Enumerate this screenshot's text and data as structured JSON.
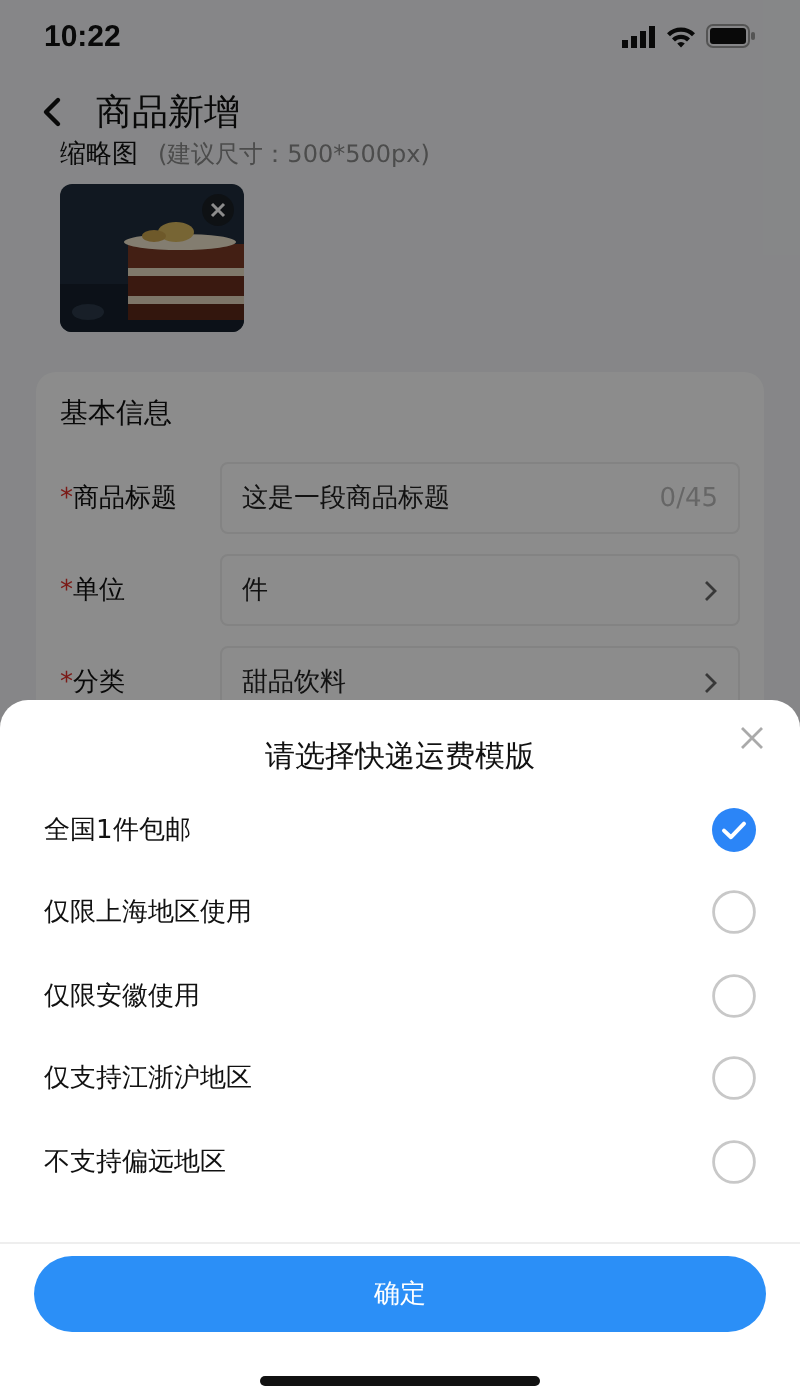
{
  "status_bar": {
    "time": "10:22"
  },
  "header": {
    "title": "商品新增"
  },
  "thumbnail": {
    "label": "缩略图",
    "hint": "(建议尺寸：500*500px)"
  },
  "basic_info": {
    "title": "基本信息",
    "fields": [
      {
        "required_mark": "*",
        "label": "商品标题",
        "kind": "text",
        "value": "这是一段商品标题",
        "counter": "0/45"
      },
      {
        "required_mark": "*",
        "label": "单位",
        "kind": "select",
        "value": "件"
      },
      {
        "required_mark": "*",
        "label": "分类",
        "kind": "select",
        "value": "甜品饮料"
      }
    ]
  },
  "sheet": {
    "title": "请选择快递运费模版",
    "options": [
      {
        "label": "全国1件包邮",
        "selected": true
      },
      {
        "label": "仅限上海地区使用",
        "selected": false
      },
      {
        "label": "仅限安徽使用",
        "selected": false
      },
      {
        "label": "仅支持江浙沪地区",
        "selected": false
      },
      {
        "label": "不支持偏远地区",
        "selected": false
      }
    ],
    "confirm": "确定"
  }
}
